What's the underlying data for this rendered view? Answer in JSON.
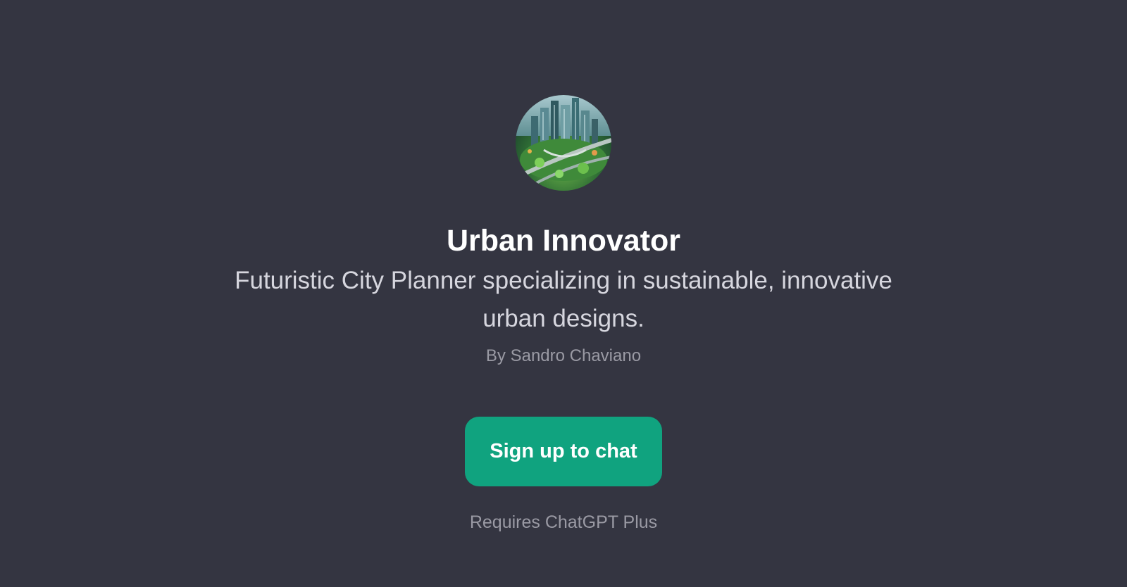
{
  "gpt": {
    "avatar_icon": "futuristic-city-icon",
    "name": "Urban Innovator",
    "description": "Futuristic City Planner specializing in sustainable, innovative urban designs.",
    "author": "By Sandro Chaviano"
  },
  "actions": {
    "signup_label": "Sign up to chat",
    "requirement_note": "Requires ChatGPT Plus"
  },
  "colors": {
    "background": "#343541",
    "button": "#10a37f",
    "title": "#ffffff",
    "description": "#d6d6de",
    "muted": "#9a9aa4"
  }
}
